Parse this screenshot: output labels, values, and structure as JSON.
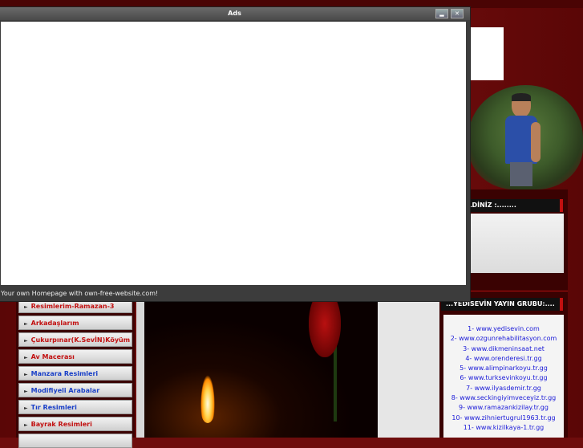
{
  "popup": {
    "title": "Ads",
    "footer": "Your own Homepage with own-free-website.com!",
    "minimize_glyph": "▂",
    "close_glyph": "✕"
  },
  "right_panel": {
    "welcome_header": "OŞ GELDİNİZ :........",
    "group_header": "...YEDİSEVİN YAYIN GRUBU:....",
    "links": [
      "1- www.yedisevin.com",
      "2- www.ozgunrehabilitasyon.com",
      "3- www.dikmeninsaat.net",
      "4- www.orenderesi.tr.gg",
      "5- www.alimpinarkoyu.tr.gg",
      "6- www.turksevinkoyu.tr.gg",
      "7- www.ilyasdemir.tr.gg",
      "8- www.seckingiyimveceyiz.tr.gg",
      "9- www.ramazankizilay.tr.gg",
      "10- www.zihniertugrul1963.tr.gg",
      "11- www.kizilkaya-1.tr.gg"
    ]
  },
  "nav": {
    "items": [
      {
        "label": "Resimlerim-Ramazan-3",
        "color": "red"
      },
      {
        "label": "Arkadaşlarım",
        "color": "red"
      },
      {
        "label": "Çukurpınar(K.SevİN)Köyüm",
        "color": "red"
      },
      {
        "label": "Av Macerası",
        "color": "red"
      },
      {
        "label": "Manzara Resimleri",
        "color": "blue"
      },
      {
        "label": "Modifiyeli Arabalar",
        "color": "blue"
      },
      {
        "label": "Tır Resimleri",
        "color": "blue"
      },
      {
        "label": "Bayrak Resimleri",
        "color": "red"
      }
    ]
  },
  "colors": {
    "background": "#6e0d0d",
    "nav_red": "#c21010",
    "nav_blue": "#1a40c8",
    "link_blue": "#1a1ad8"
  }
}
